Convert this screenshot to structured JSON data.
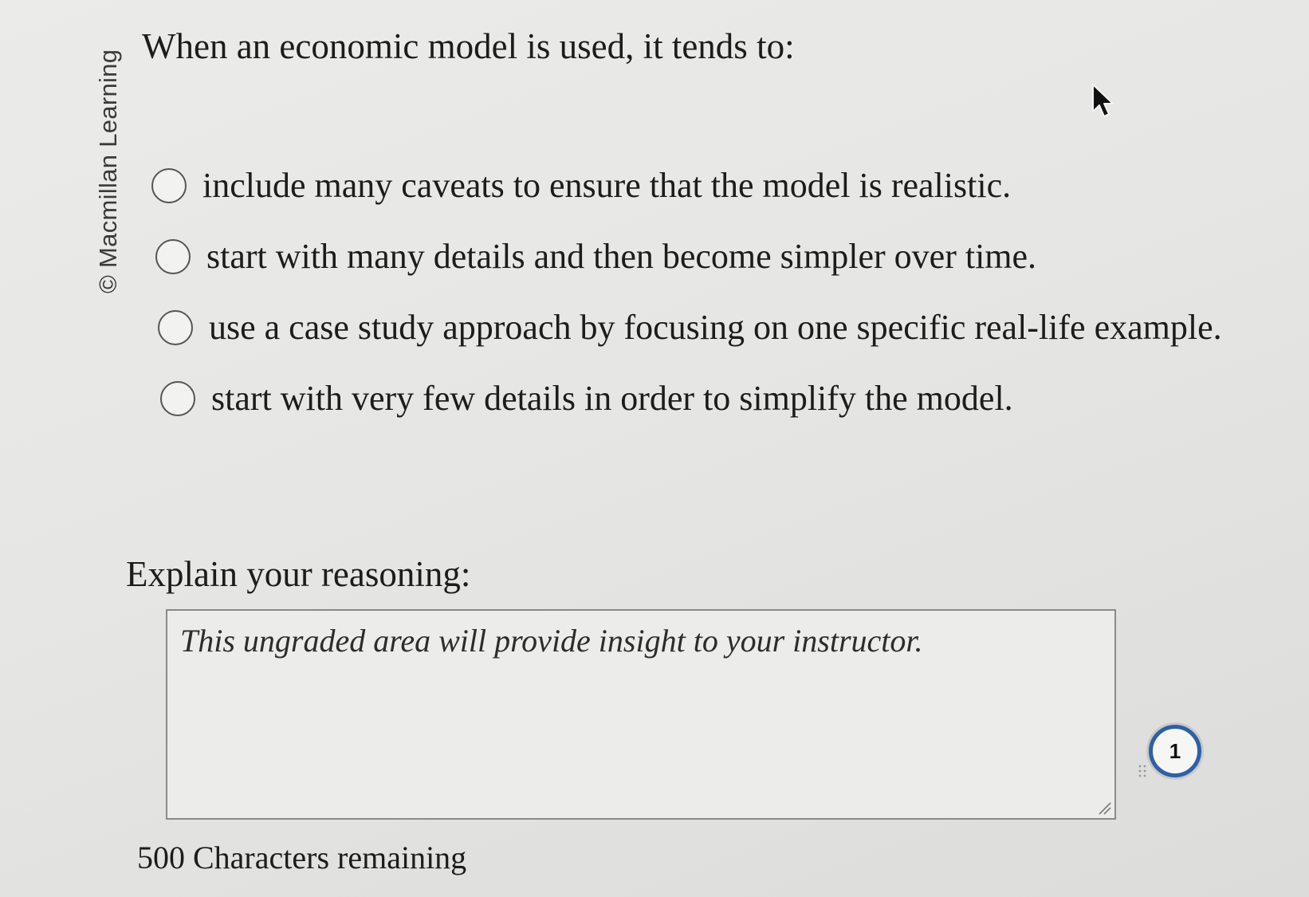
{
  "watermark": "© Macmillan Learning",
  "question": {
    "prompt": "When an economic model is used, it tends to:"
  },
  "options": [
    {
      "label": "include many caveats to ensure that the model is realistic.",
      "selected": false
    },
    {
      "label": "start with many details and then become simpler over time.",
      "selected": false
    },
    {
      "label": "use a case study approach by focusing on one specific real-life example.",
      "selected": false
    },
    {
      "label": "start with very few details in order to simplify the model.",
      "selected": false
    }
  ],
  "reasoning": {
    "label": "Explain your reasoning:",
    "placeholder": "This ungraded area will provide insight to your instructor.",
    "counter": "500 Characters remaining"
  },
  "badge": {
    "count": "1"
  },
  "icons": [
    "radio-circle-icon",
    "resize-handle-icon",
    "drag-handle-icon",
    "mouse-cursor-icon"
  ],
  "colors": {
    "badge_ring": "#2f5fa6",
    "text": "#1c1c1c"
  }
}
